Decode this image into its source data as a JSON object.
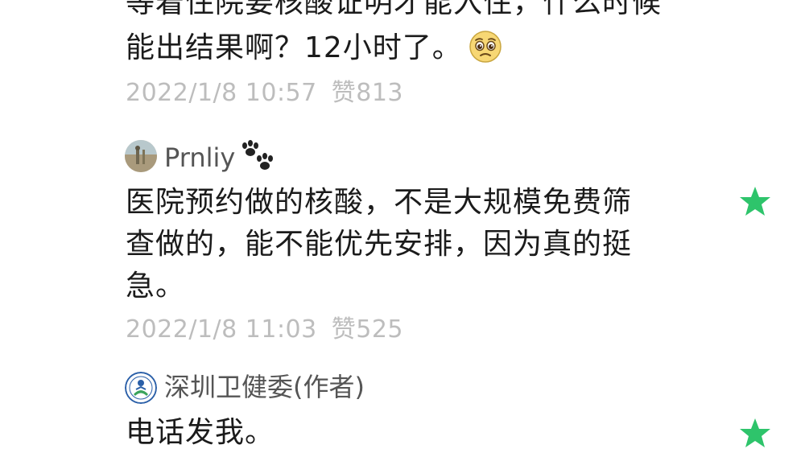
{
  "comment_prev": {
    "line1_partial": "等着住院要核酸证明才能入住，什么时候",
    "line2": "能出结果啊？12小时了。",
    "emoji_icon": "pleading-face-icon",
    "date": "2022/1/8 10:57",
    "likes": "赞813"
  },
  "comment_prnliy": {
    "username": "Prnliy",
    "username_icon": "paw-prints-icon",
    "lines": [
      "医院预约做的核酸，不是大规模免费筛",
      "查做的，能不能优先安排，因为真的挺",
      "急。"
    ],
    "date": "2022/1/8 11:03",
    "likes": "赞525",
    "star_icon": "star-icon"
  },
  "reply_author": {
    "username": "深圳卫健委(作者)",
    "text": "电话发我。",
    "star_icon": "star-icon"
  },
  "colors": {
    "text": "#1b1b1b",
    "meta": "#bdbdbd",
    "username": "#555555",
    "star": "#2ec46b"
  }
}
